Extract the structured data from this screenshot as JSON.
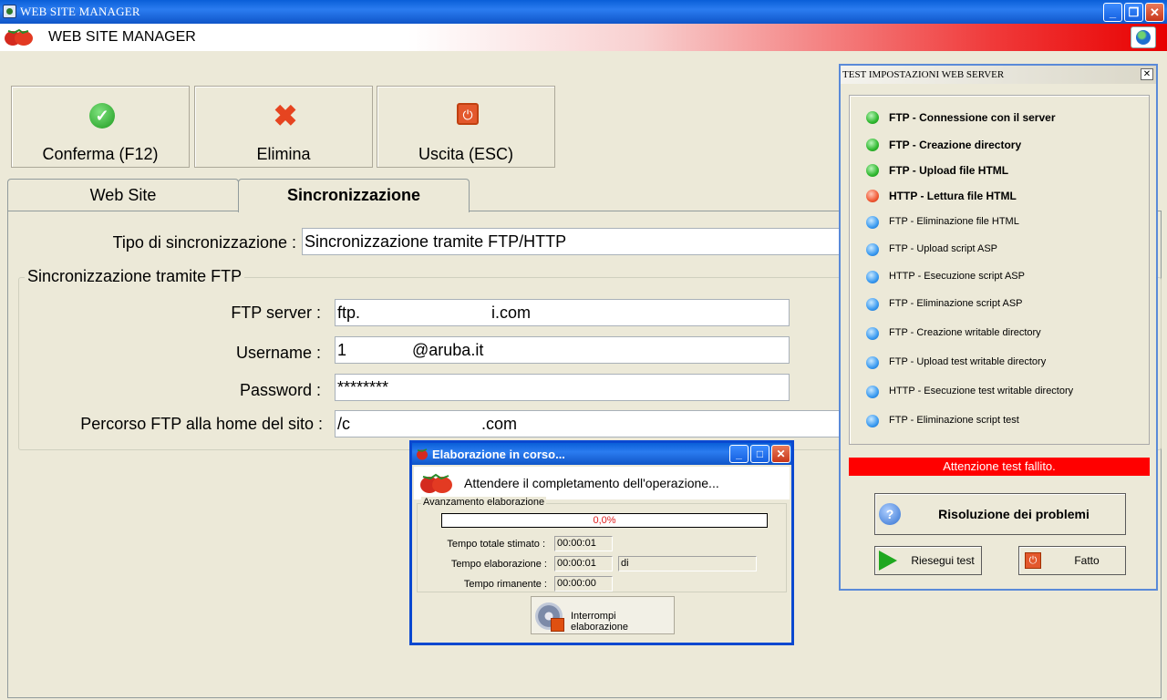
{
  "window": {
    "title": "WEB SITE MANAGER"
  },
  "banner": {
    "title": "WEB SITE MANAGER"
  },
  "toolbar": {
    "confirm_label": "Conferma (F12)",
    "delete_label": "Elimina",
    "exit_label": "Uscita (ESC)"
  },
  "tabs": [
    {
      "label": "Web Site"
    },
    {
      "label": "Sincronizzazione"
    }
  ],
  "sync": {
    "type_label": "Tipo di sincronizzazione :",
    "type_value": "Sincronizzazione tramite FTP/HTTP",
    "group_label": "Sincronizzazione tramite FTP",
    "ftp_server_label": "FTP server :",
    "ftp_server_value": "ftp.        i.com",
    "username_label": "Username :",
    "username_value": "1    @aruba.it",
    "password_label": "Password :",
    "password_value": "********",
    "path_label": "Percorso FTP alla home del sito :",
    "path_value": "/c        .com"
  },
  "progress_dialog": {
    "title": "Elaborazione in corso...",
    "message": "Attendere il completamento dell'operazione...",
    "group_label": "Avanzamento elaborazione",
    "percent_text": "0,0%",
    "progress": 0,
    "total_label": "Tempo totale stimato :",
    "total_value": "00:00:01",
    "elapsed_label": "Tempo elaborazione :",
    "elapsed_value": "00:00:01",
    "elapsed_extra": "di",
    "remaining_label": "Tempo rimanente :",
    "remaining_value": "00:00:00",
    "stop_label": "Interrompi elaborazione"
  },
  "test_panel": {
    "title": "TEST IMPOSTAZIONI WEB SERVER",
    "items": [
      {
        "label": "FTP - Connessione con il server",
        "status": "green",
        "bold": true
      },
      {
        "label": "FTP - Creazione directory",
        "status": "green",
        "bold": true
      },
      {
        "label": "FTP - Upload file HTML",
        "status": "green",
        "bold": true
      },
      {
        "label": "HTTP - Lettura file HTML",
        "status": "red",
        "bold": true
      },
      {
        "label": "FTP - Eliminazione file HTML",
        "status": "blue",
        "bold": false
      },
      {
        "label": "FTP - Upload script ASP",
        "status": "blue",
        "bold": false
      },
      {
        "label": "HTTP - Esecuzione script ASP",
        "status": "blue",
        "bold": false
      },
      {
        "label": "FTP - Eliminazione script ASP",
        "status": "blue",
        "bold": false
      },
      {
        "label": "FTP - Creazione writable directory",
        "status": "blue",
        "bold": false
      },
      {
        "label": "FTP - Upload test writable directory",
        "status": "blue",
        "bold": false
      },
      {
        "label": "HTTP - Esecuzione test writable directory",
        "status": "blue",
        "bold": false
      },
      {
        "label": "FTP - Eliminazione script test",
        "status": "blue",
        "bold": false
      }
    ],
    "fail_text": "Attenzione test fallito.",
    "solve_label": "Risoluzione dei problemi",
    "retry_label": "Riesegui test",
    "done_label": "Fatto"
  }
}
